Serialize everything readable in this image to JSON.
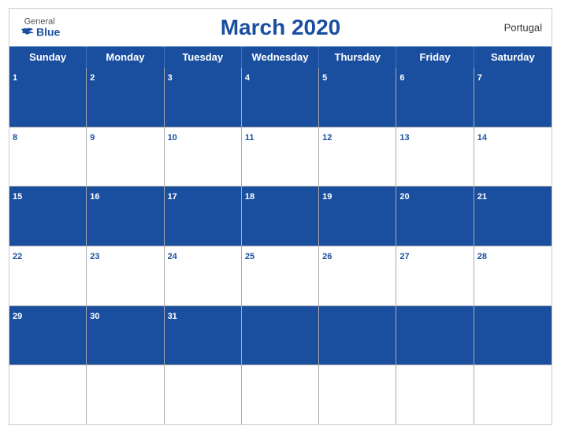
{
  "header": {
    "logo_general": "General",
    "logo_blue": "Blue",
    "title": "March 2020",
    "country": "Portugal"
  },
  "days_of_week": [
    "Sunday",
    "Monday",
    "Tuesday",
    "Wednesday",
    "Thursday",
    "Friday",
    "Saturday"
  ],
  "weeks": [
    {
      "type": "header",
      "days": [
        {
          "num": "1",
          "empty": false
        },
        {
          "num": "2",
          "empty": false
        },
        {
          "num": "3",
          "empty": false
        },
        {
          "num": "4",
          "empty": false
        },
        {
          "num": "5",
          "empty": false
        },
        {
          "num": "6",
          "empty": false
        },
        {
          "num": "7",
          "empty": false
        }
      ]
    },
    {
      "type": "content",
      "days": [
        {
          "num": "8",
          "empty": false
        },
        {
          "num": "9",
          "empty": false
        },
        {
          "num": "10",
          "empty": false
        },
        {
          "num": "11",
          "empty": false
        },
        {
          "num": "12",
          "empty": false
        },
        {
          "num": "13",
          "empty": false
        },
        {
          "num": "14",
          "empty": false
        }
      ]
    },
    {
      "type": "header",
      "days": [
        {
          "num": "15",
          "empty": false
        },
        {
          "num": "16",
          "empty": false
        },
        {
          "num": "17",
          "empty": false
        },
        {
          "num": "18",
          "empty": false
        },
        {
          "num": "19",
          "empty": false
        },
        {
          "num": "20",
          "empty": false
        },
        {
          "num": "21",
          "empty": false
        }
      ]
    },
    {
      "type": "content",
      "days": [
        {
          "num": "22",
          "empty": false
        },
        {
          "num": "23",
          "empty": false
        },
        {
          "num": "24",
          "empty": false
        },
        {
          "num": "25",
          "empty": false
        },
        {
          "num": "26",
          "empty": false
        },
        {
          "num": "27",
          "empty": false
        },
        {
          "num": "28",
          "empty": false
        }
      ]
    },
    {
      "type": "header",
      "days": [
        {
          "num": "29",
          "empty": false
        },
        {
          "num": "30",
          "empty": false
        },
        {
          "num": "31",
          "empty": false
        },
        {
          "num": "",
          "empty": true
        },
        {
          "num": "",
          "empty": true
        },
        {
          "num": "",
          "empty": true
        },
        {
          "num": "",
          "empty": true
        }
      ]
    },
    {
      "type": "content",
      "days": [
        {
          "num": "",
          "empty": true
        },
        {
          "num": "",
          "empty": true
        },
        {
          "num": "",
          "empty": true
        },
        {
          "num": "",
          "empty": true
        },
        {
          "num": "",
          "empty": true
        },
        {
          "num": "",
          "empty": true
        },
        {
          "num": "",
          "empty": true
        }
      ]
    }
  ]
}
